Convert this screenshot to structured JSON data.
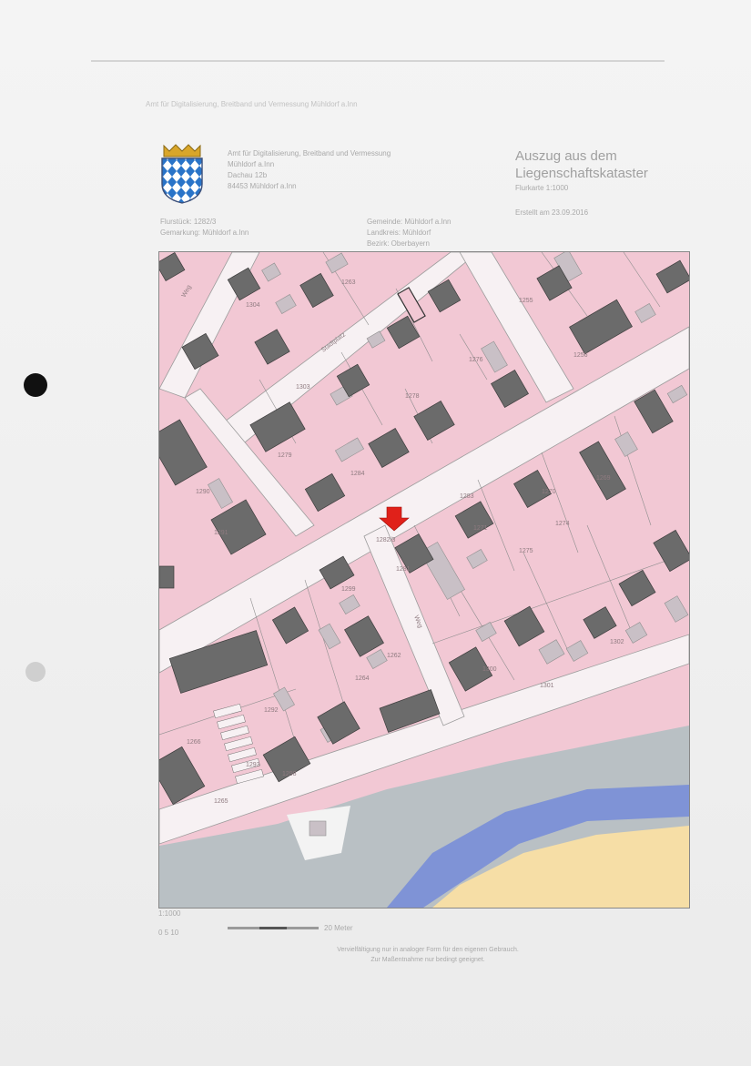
{
  "header": {
    "office_lines": [
      "Amt für Digitalisierung, Breitband und Vermessung",
      "Mühldorf a.Inn",
      "Dachau 12b",
      "84453 Mühldorf a.Inn"
    ],
    "title_line1": "Auszug aus dem",
    "title_line2": "Liegenschaftskataster",
    "title_sub": "Flurkarte 1:1000",
    "date_line": "Erstellt am 23.09.2016",
    "meta_left": [
      "Flurstück:  1282/3",
      "Gemarkung:  Mühldorf a.Inn"
    ],
    "meta_right": [
      "Gemeinde:  Mühldorf a.Inn",
      "Landkreis:  Mühldorf",
      "Bezirk:  Oberbayern"
    ],
    "top_faint": "Amt für Digitalisierung, Breitband und Vermessung Mühldorf a.Inn"
  },
  "map": {
    "north_label": "1:1000",
    "parcel_labels": [
      "1282/3",
      "1283",
      "1284",
      "1281",
      "1279",
      "1278",
      "1276",
      "1275",
      "1274",
      "1290",
      "1291",
      "1292",
      "1293",
      "1271",
      "1270",
      "1269",
      "1266",
      "1265",
      "1264",
      "1262",
      "1298",
      "1299",
      "1300",
      "1301",
      "1302",
      "1303",
      "1304",
      "1263",
      "1255",
      "1256"
    ],
    "street_labels": [
      "Weg",
      "Stadtplatz",
      "Weg"
    ],
    "colors": {
      "parcel": "#f2c8d4",
      "building": "#6b6b6b",
      "outbuilding": "#c9c0c6",
      "street": "#f7f1f3",
      "river": "#7f93d6",
      "water_bank": "#b9c0c4",
      "sand": "#f6dea6",
      "marker": "#e0211a"
    }
  },
  "scale": {
    "label_left": "0  5  10",
    "label_right": "20 Meter"
  },
  "footer": {
    "line1": "Vervielfältigung nur in analoger Form für den eigenen Gebrauch.",
    "line2": "Zur Maßentnahme nur bedingt geeignet."
  }
}
